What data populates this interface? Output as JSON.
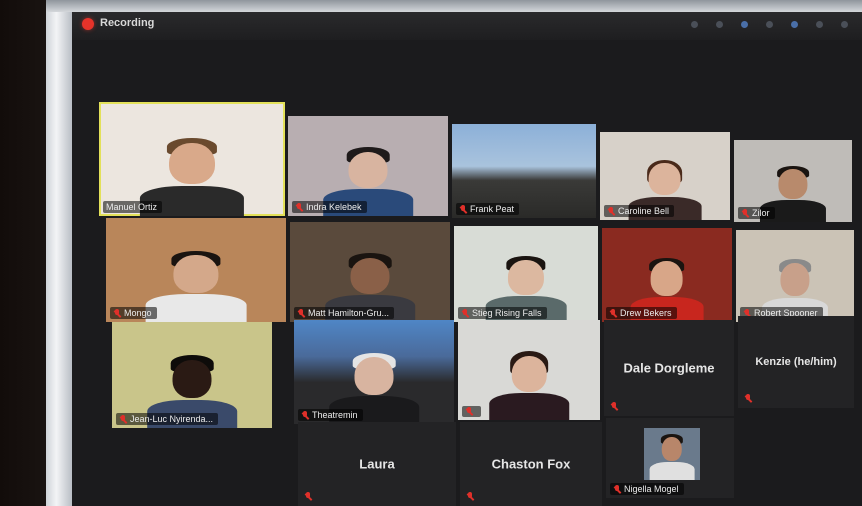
{
  "recording": {
    "label": "Recording",
    "dot_color": "#e5332a"
  },
  "participants": [
    {
      "name": "Manuel Ortiz",
      "active": true
    },
    {
      "name": "Indra Kelebek"
    },
    {
      "name": "Frank Peat"
    },
    {
      "name": "Caroline Bell"
    },
    {
      "name": "Zilor"
    },
    {
      "name": "Mongo"
    },
    {
      "name": "Matt Hamilton-Gru..."
    },
    {
      "name": "Stieg Rising Falls"
    },
    {
      "name": "Drew Bekers"
    },
    {
      "name": "Robert Spooner"
    },
    {
      "name": "Jean-Luc Nyirenda..."
    },
    {
      "name": "Theatremin"
    },
    {
      "name": ""
    },
    {
      "name": "Dale Dorgleme"
    },
    {
      "name": "Kenzie (he/him)"
    },
    {
      "name": "Laura"
    },
    {
      "name": "Chaston Fox"
    },
    {
      "name": "Nigella Mogel"
    }
  ],
  "colors": {
    "active_speaker": "#e3e15a",
    "muted_mic": "#e0302a",
    "tile_bg": "#232325"
  }
}
